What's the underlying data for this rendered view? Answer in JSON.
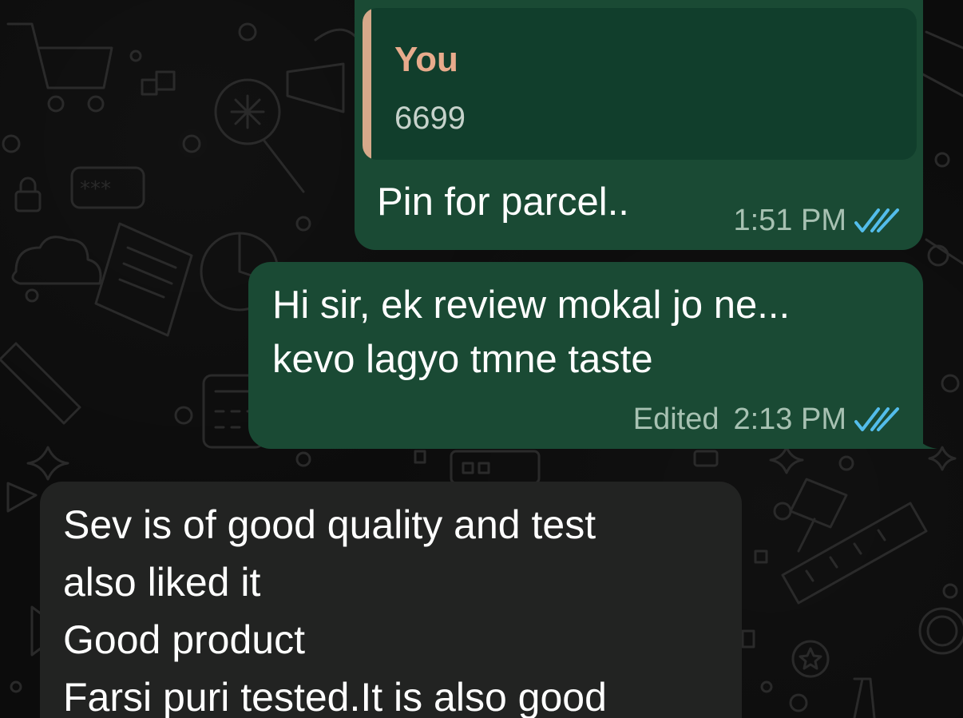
{
  "messages": [
    {
      "direction": "outgoing",
      "quote": {
        "author": "You",
        "text": "6699"
      },
      "text": "Pin for parcel..",
      "time": "1:51 PM",
      "status_icon": "double-check-read-icon"
    },
    {
      "direction": "outgoing",
      "lines": [
        "Hi sir, ek review mokal jo ne...",
        "kevo lagyo tmne taste"
      ],
      "edited_label": "Edited",
      "time": "2:13 PM",
      "status_icon": "double-check-read-icon"
    },
    {
      "direction": "incoming",
      "lines": [
        "Sev is of good quality and test",
        "also liked it",
        "Good product",
        "Farsi puri tested.It is also good"
      ]
    }
  ],
  "colors": {
    "background": "#0c0c0c",
    "outgoing_bubble": "#1a4a34",
    "incoming_bubble": "#222322",
    "quote_background": "#113e2c",
    "quote_bar": "#d6a98a",
    "quote_author": "#e8ab8c",
    "read_ticks": "#53bdeb",
    "meta_text": "#a7c1b2"
  }
}
